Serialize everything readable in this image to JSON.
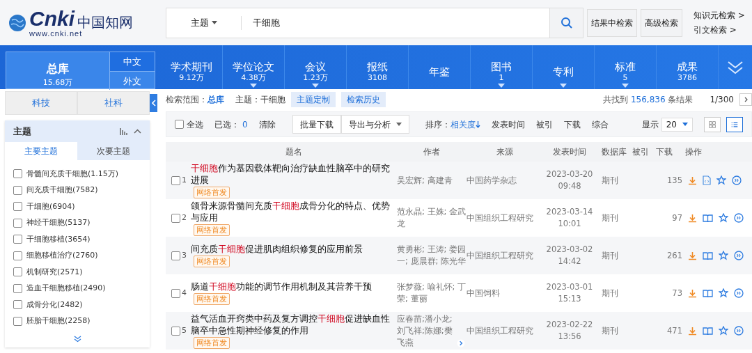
{
  "header": {
    "logo": {
      "mark": "Cnki",
      "name": "中国知网",
      "url": "www.cnki.net"
    },
    "search": {
      "field": "主题",
      "value": "干细胞"
    },
    "buttons": [
      "结果中检索",
      "高级检索"
    ],
    "links": [
      "知识元检索 >",
      "引文检索 >"
    ]
  },
  "nav": {
    "main": {
      "label": "总库",
      "count": "15.68万",
      "langs": [
        {
          "label": "中文",
          "selected": true
        },
        {
          "label": "外文",
          "selected": false
        }
      ]
    },
    "tabs": [
      {
        "label": "学术期刊",
        "count": "9.12万",
        "has_menu": false
      },
      {
        "label": "学位论文",
        "count": "4.38万",
        "has_menu": true
      },
      {
        "label": "会议",
        "count": "1.23万",
        "has_menu": true
      },
      {
        "label": "报纸",
        "count": "3108",
        "has_menu": false
      },
      {
        "label": "年鉴",
        "has_menu": false
      },
      {
        "label": "图书",
        "count": "1",
        "has_menu": true
      },
      {
        "label": "专利",
        "has_menu": true
      },
      {
        "label": "标准",
        "count": "5",
        "has_menu": true
      },
      {
        "label": "成果",
        "count": "3786",
        "has_menu": false
      }
    ]
  },
  "sidebar": {
    "categories": [
      "科技",
      "社科"
    ],
    "panel_title": "主题",
    "subtabs": [
      {
        "label": "主要主题",
        "selected": true
      },
      {
        "label": "次要主题",
        "selected": false
      }
    ],
    "items": [
      {
        "label": "骨髓间充质干细胞(1.15万)",
        "checked": false
      },
      {
        "label": "间充质干细胞(7582)",
        "checked": false
      },
      {
        "label": "干细胞(6904)",
        "checked": false
      },
      {
        "label": "神经干细胞(5137)",
        "checked": false
      },
      {
        "label": "干细胞移植(3654)",
        "checked": false
      },
      {
        "label": "细胞移植治疗(2760)",
        "checked": false
      },
      {
        "label": "机制研究(2571)",
        "checked": false
      },
      {
        "label": "造血干细胞移植(2490)",
        "checked": false
      },
      {
        "label": "成骨分化(2482)",
        "checked": false
      },
      {
        "label": "胚胎干细胞(2258)",
        "checked": false
      }
    ]
  },
  "scope": {
    "label": "检索范围：",
    "value": "总库",
    "topic": "主题：干细胞",
    "buttons": [
      "主题定制",
      "检索历史"
    ],
    "result_prefix": "共找到",
    "result_count": "156,836",
    "result_suffix": "条结果",
    "page": "1/300"
  },
  "toolbar": {
    "select_all": {
      "label": "全选",
      "checked": false
    },
    "selected_label": "已选：",
    "selected_count": "0",
    "clear": "清除",
    "buttons": [
      "批量下载",
      "导出与分析"
    ],
    "sort_label": "排序：",
    "sorts": [
      {
        "label": "相关度",
        "selected": true
      },
      {
        "label": "发表时间",
        "selected": false
      },
      {
        "label": "被引",
        "selected": false
      },
      {
        "label": "下载",
        "selected": false
      },
      {
        "label": "综合",
        "selected": false
      }
    ],
    "show_label": "显示",
    "show_value": "20",
    "views": [
      {
        "kind": "grid",
        "selected": false
      },
      {
        "kind": "list",
        "selected": true
      }
    ]
  },
  "table": {
    "columns": [
      "题名",
      "作者",
      "来源",
      "发表时间",
      "数据库",
      "被引",
      "下载",
      "操作"
    ],
    "rows": [
      {
        "index": "1",
        "checked": false,
        "title_parts": [
          {
            "text": "干细胞",
            "hit": true
          },
          {
            "text": "作为基因载体靶向治疗缺血性脑卒中的研究进展",
            "hit": false
          }
        ],
        "tag": "网络首发",
        "authors": "吴宏辉; 高建青",
        "source": "中国药学杂志",
        "date": "2023-03-20",
        "time": "09:48",
        "db": "期刊",
        "downloads": "135",
        "reader": {
          "kind": "html"
        },
        "more": false
      },
      {
        "index": "2",
        "checked": false,
        "title_parts": [
          {
            "text": "颌骨来源骨髓间充质",
            "hit": false
          },
          {
            "text": "干细胞",
            "hit": true
          },
          {
            "text": "成骨分化的特点、优势与应用",
            "hit": false
          }
        ],
        "tag": "网络首发",
        "authors": "范永晶; 王姝; 金武龙",
        "source": "中国组织工程研究",
        "date": "2023-03-14",
        "time": "10:01",
        "db": "期刊",
        "downloads": "97",
        "reader": {
          "kind": "book"
        },
        "more": false
      },
      {
        "index": "3",
        "checked": false,
        "title_parts": [
          {
            "text": "间充质",
            "hit": false
          },
          {
            "text": "干细胞",
            "hit": true
          },
          {
            "text": "促进肌肉组织修复的应用前景",
            "hit": false
          }
        ],
        "tag": "网络首发",
        "authors": "黄勇彬; 王涛; 娄园一; 庞晨群; 陈光华",
        "source": "中国组织工程研究",
        "date": "2023-03-02",
        "time": "14:42",
        "db": "期刊",
        "downloads": "261",
        "reader": {
          "kind": "book"
        },
        "more": false
      },
      {
        "index": "4",
        "checked": false,
        "title_parts": [
          {
            "text": "肠道",
            "hit": false
          },
          {
            "text": "干细胞",
            "hit": true
          },
          {
            "text": "功能的调节作用机制及其营养干预",
            "hit": false
          }
        ],
        "tag": "网络首发",
        "authors": "张梦薇; 喻礼怀; 丁荣; 董丽",
        "source": "中国饲料",
        "date": "2023-03-01",
        "time": "15:13",
        "db": "期刊",
        "downloads": "73",
        "reader": {
          "kind": "book"
        },
        "more": false
      },
      {
        "index": "5",
        "checked": false,
        "title_parts": [
          {
            "text": "益气活血开窍类中药及复方调控",
            "hit": false
          },
          {
            "text": "干细胞",
            "hit": true
          },
          {
            "text": "促进缺血性脑卒中急性期神经修复的作用",
            "hit": false
          }
        ],
        "tag": "网络首发",
        "authors": "应春苗;潘小龙;刘飞祥;陈娜;樊飞燕",
        "source": "中国组织工程研究",
        "date": "2023-02-22",
        "time": "13:56",
        "db": "期刊",
        "downloads": "471",
        "reader": {
          "kind": "book"
        },
        "more": true
      }
    ]
  }
}
